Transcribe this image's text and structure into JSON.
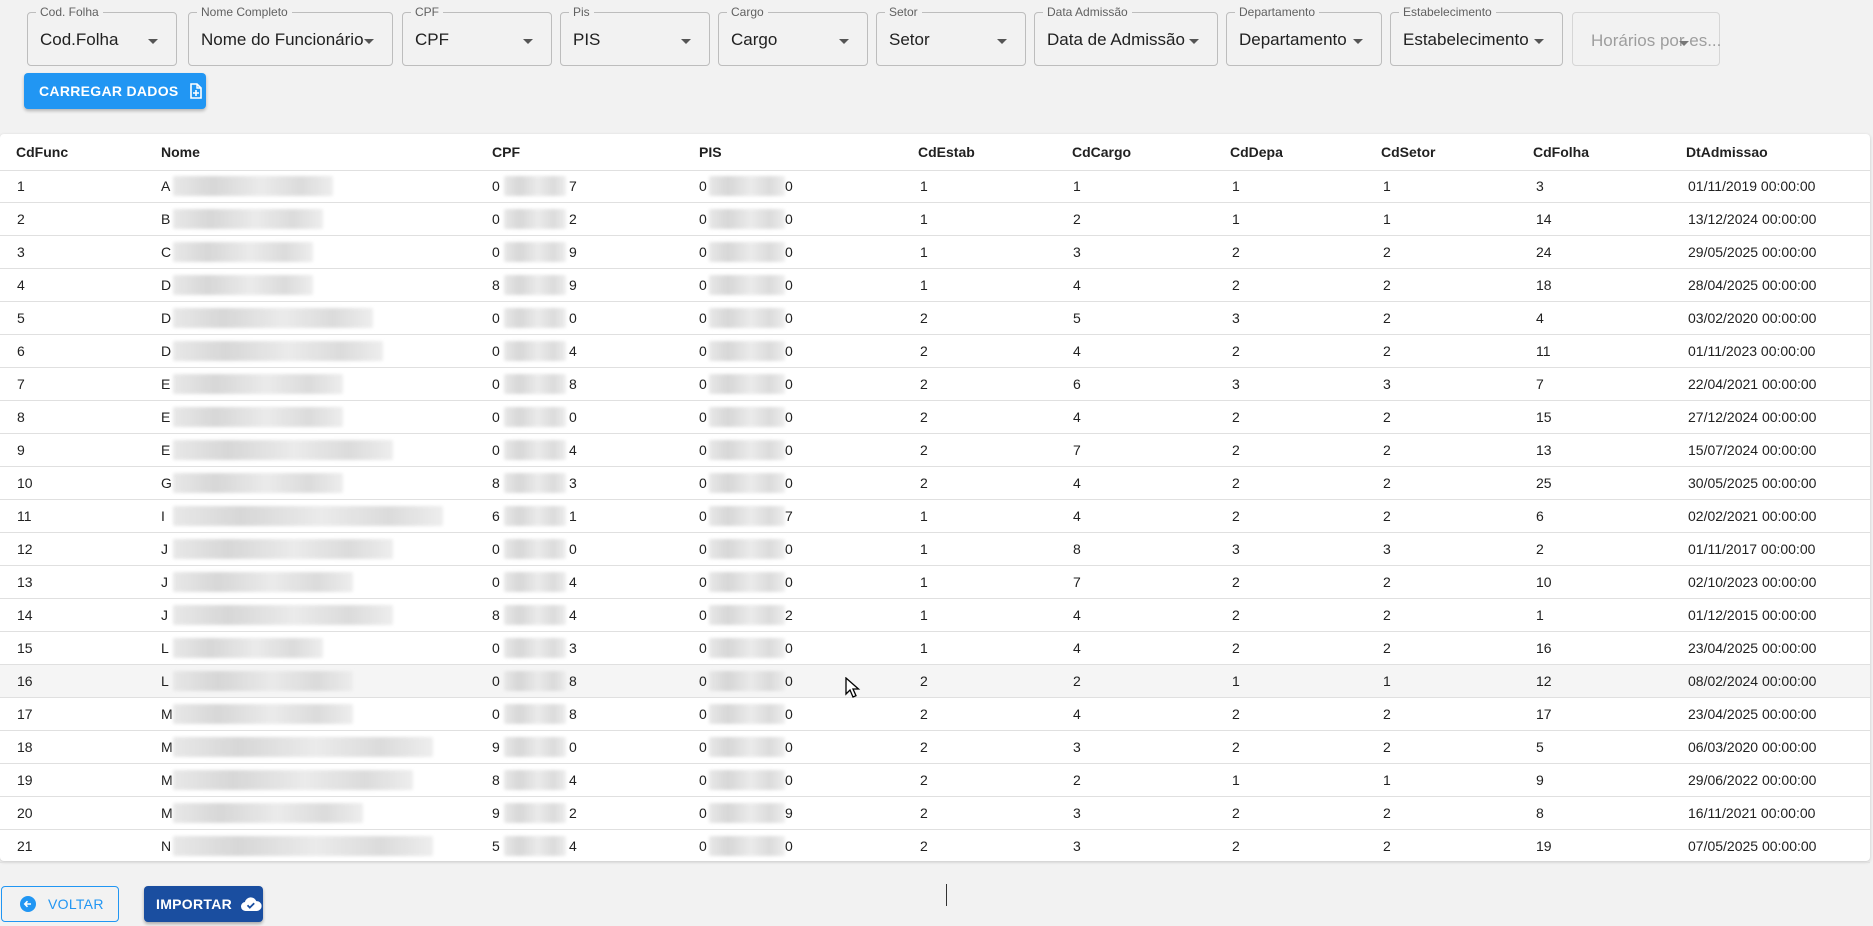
{
  "filters": [
    {
      "label": "Cod. Folha",
      "value": "Cod.Folha"
    },
    {
      "label": "Nome Completo",
      "value": "Nome do Funcionário"
    },
    {
      "label": "CPF",
      "value": "CPF"
    },
    {
      "label": "Pis",
      "value": "PIS"
    },
    {
      "label": "Cargo",
      "value": "Cargo"
    },
    {
      "label": "Setor",
      "value": "Setor"
    },
    {
      "label": "Data Admissão",
      "value": "Data de Admissão"
    },
    {
      "label": "Departamento",
      "value": "Departamento"
    },
    {
      "label": "Estabelecimento",
      "value": "Estabelecimento"
    },
    {
      "label": "",
      "value": "Horários por es..."
    }
  ],
  "load_button": {
    "label": "CARREGAR DADOS",
    "icon": "file-plus-icon"
  },
  "table": {
    "columns": [
      "CdFunc",
      "Nome",
      "CPF",
      "PIS",
      "CdEstab",
      "CdCargo",
      "CdDepa",
      "CdSetor",
      "CdFolha",
      "DtAdmissao"
    ],
    "rows": [
      {
        "cdfunc": "1",
        "nome": "A",
        "cpf_start": "0",
        "cpf_end": "7",
        "pis_start": "0",
        "pis_end": "0",
        "cdestab": "1",
        "cdcargo": "1",
        "cddepa": "1",
        "cdsetor": "1",
        "cdfolha": "3",
        "dt": "01/11/2019 00:00:00"
      },
      {
        "cdfunc": "2",
        "nome": "B",
        "cpf_start": "0",
        "cpf_end": "2",
        "pis_start": "0",
        "pis_end": "0",
        "cdestab": "1",
        "cdcargo": "2",
        "cddepa": "1",
        "cdsetor": "1",
        "cdfolha": "14",
        "dt": "13/12/2024 00:00:00"
      },
      {
        "cdfunc": "3",
        "nome": "C",
        "cpf_start": "0",
        "cpf_end": "9",
        "pis_start": "0",
        "pis_end": "0",
        "cdestab": "1",
        "cdcargo": "3",
        "cddepa": "2",
        "cdsetor": "2",
        "cdfolha": "24",
        "dt": "29/05/2025 00:00:00"
      },
      {
        "cdfunc": "4",
        "nome": "D",
        "cpf_start": "8",
        "cpf_end": "9",
        "pis_start": "0",
        "pis_end": "0",
        "cdestab": "1",
        "cdcargo": "4",
        "cddepa": "2",
        "cdsetor": "2",
        "cdfolha": "18",
        "dt": "28/04/2025 00:00:00"
      },
      {
        "cdfunc": "5",
        "nome": "D",
        "cpf_start": "0",
        "cpf_end": "0",
        "pis_start": "0",
        "pis_end": "0",
        "cdestab": "2",
        "cdcargo": "5",
        "cddepa": "3",
        "cdsetor": "2",
        "cdfolha": "4",
        "dt": "03/02/2020 00:00:00"
      },
      {
        "cdfunc": "6",
        "nome": "D",
        "cpf_start": "0",
        "cpf_end": "4",
        "pis_start": "0",
        "pis_end": "0",
        "cdestab": "2",
        "cdcargo": "4",
        "cddepa": "2",
        "cdsetor": "2",
        "cdfolha": "11",
        "dt": "01/11/2023 00:00:00"
      },
      {
        "cdfunc": "7",
        "nome": "E",
        "cpf_start": "0",
        "cpf_end": "8",
        "pis_start": "0",
        "pis_end": "0",
        "cdestab": "2",
        "cdcargo": "6",
        "cddepa": "3",
        "cdsetor": "3",
        "cdfolha": "7",
        "dt": "22/04/2021 00:00:00"
      },
      {
        "cdfunc": "8",
        "nome": "E",
        "cpf_start": "0",
        "cpf_end": "0",
        "pis_start": "0",
        "pis_end": "0",
        "cdestab": "2",
        "cdcargo": "4",
        "cddepa": "2",
        "cdsetor": "2",
        "cdfolha": "15",
        "dt": "27/12/2024 00:00:00"
      },
      {
        "cdfunc": "9",
        "nome": "E",
        "cpf_start": "0",
        "cpf_end": "4",
        "pis_start": "0",
        "pis_end": "0",
        "cdestab": "2",
        "cdcargo": "7",
        "cddepa": "2",
        "cdsetor": "2",
        "cdfolha": "13",
        "dt": "15/07/2024 00:00:00"
      },
      {
        "cdfunc": "10",
        "nome": "G",
        "cpf_start": "8",
        "cpf_end": "3",
        "pis_start": "0",
        "pis_end": "0",
        "cdestab": "2",
        "cdcargo": "4",
        "cddepa": "2",
        "cdsetor": "2",
        "cdfolha": "25",
        "dt": "30/05/2025 00:00:00"
      },
      {
        "cdfunc": "11",
        "nome": "I",
        "cpf_start": "6",
        "cpf_end": "1",
        "pis_start": "0",
        "pis_end": "7",
        "cdestab": "1",
        "cdcargo": "4",
        "cddepa": "2",
        "cdsetor": "2",
        "cdfolha": "6",
        "dt": "02/02/2021 00:00:00"
      },
      {
        "cdfunc": "12",
        "nome": "J",
        "cpf_start": "0",
        "cpf_end": "0",
        "pis_start": "0",
        "pis_end": "0",
        "cdestab": "1",
        "cdcargo": "8",
        "cddepa": "3",
        "cdsetor": "3",
        "cdfolha": "2",
        "dt": "01/11/2017 00:00:00"
      },
      {
        "cdfunc": "13",
        "nome": "J",
        "cpf_start": "0",
        "cpf_end": "4",
        "pis_start": "0",
        "pis_end": "0",
        "cdestab": "1",
        "cdcargo": "7",
        "cddepa": "2",
        "cdsetor": "2",
        "cdfolha": "10",
        "dt": "02/10/2023 00:00:00"
      },
      {
        "cdfunc": "14",
        "nome": "J",
        "cpf_start": "8",
        "cpf_end": "4",
        "pis_start": "0",
        "pis_end": "2",
        "cdestab": "1",
        "cdcargo": "4",
        "cddepa": "2",
        "cdsetor": "2",
        "cdfolha": "1",
        "dt": "01/12/2015 00:00:00"
      },
      {
        "cdfunc": "15",
        "nome": "L",
        "cpf_start": "0",
        "cpf_end": "3",
        "pis_start": "0",
        "pis_end": "0",
        "cdestab": "1",
        "cdcargo": "4",
        "cddepa": "2",
        "cdsetor": "2",
        "cdfolha": "16",
        "dt": "23/04/2025 00:00:00"
      },
      {
        "cdfunc": "16",
        "nome": "L",
        "cpf_start": "0",
        "cpf_end": "8",
        "pis_start": "0",
        "pis_end": "0",
        "cdestab": "2",
        "cdcargo": "2",
        "cddepa": "1",
        "cdsetor": "1",
        "cdfolha": "12",
        "dt": "08/02/2024 00:00:00"
      },
      {
        "cdfunc": "17",
        "nome": "M",
        "cpf_start": "0",
        "cpf_end": "8",
        "pis_start": "0",
        "pis_end": "0",
        "cdestab": "2",
        "cdcargo": "4",
        "cddepa": "2",
        "cdsetor": "2",
        "cdfolha": "17",
        "dt": "23/04/2025 00:00:00"
      },
      {
        "cdfunc": "18",
        "nome": "M",
        "cpf_start": "9",
        "cpf_end": "0",
        "pis_start": "0",
        "pis_end": "0",
        "cdestab": "2",
        "cdcargo": "3",
        "cddepa": "2",
        "cdsetor": "2",
        "cdfolha": "5",
        "dt": "06/03/2020 00:00:00"
      },
      {
        "cdfunc": "19",
        "nome": "M",
        "cpf_start": "8",
        "cpf_end": "4",
        "pis_start": "0",
        "pis_end": "0",
        "cdestab": "2",
        "cdcargo": "2",
        "cddepa": "1",
        "cdsetor": "1",
        "cdfolha": "9",
        "dt": "29/06/2022 00:00:00"
      },
      {
        "cdfunc": "20",
        "nome": "M",
        "cpf_start": "9",
        "cpf_end": "2",
        "pis_start": "0",
        "pis_end": "9",
        "cdestab": "2",
        "cdcargo": "3",
        "cddepa": "2",
        "cdsetor": "2",
        "cdfolha": "8",
        "dt": "16/11/2021 00:00:00"
      },
      {
        "cdfunc": "21",
        "nome": "N",
        "cpf_start": "5",
        "cpf_end": "4",
        "pis_start": "0",
        "pis_end": "0",
        "cdestab": "2",
        "cdcargo": "3",
        "cddepa": "2",
        "cdsetor": "2",
        "cdfolha": "19",
        "dt": "07/05/2025 00:00:00"
      }
    ]
  },
  "footer": {
    "back_label": "VOLTAR",
    "back_icon": "arrow-left-circle-icon",
    "import_label": "IMPORTAR",
    "import_icon": "cloud-check-icon"
  },
  "colors": {
    "primary": "#2196f3",
    "primary_dark": "#1a4ea0",
    "background": "#f2f2f2"
  }
}
